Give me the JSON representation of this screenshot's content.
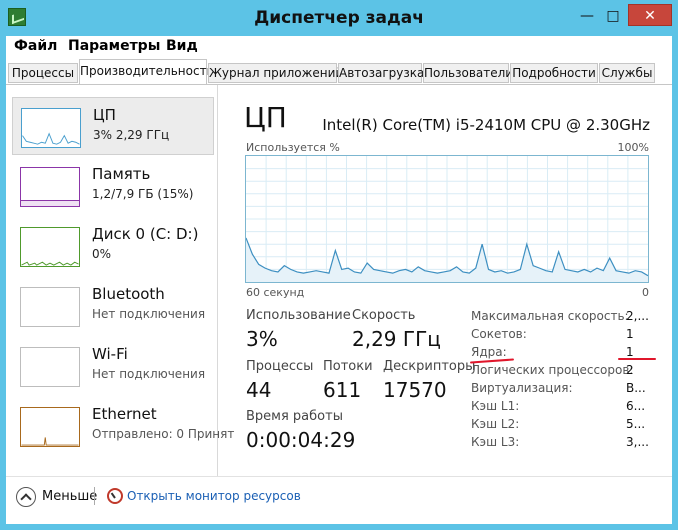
{
  "window": {
    "title": "Диспетчер задач"
  },
  "menu": [
    "Файл",
    "Параметры",
    "Вид"
  ],
  "tabs": [
    "Процессы",
    "Производительность",
    "Журнал приложений",
    "Автозагрузка",
    "Пользователи",
    "Подробности",
    "Службы"
  ],
  "active_tab": "Производительность",
  "sidebar": [
    {
      "title": "ЦП",
      "sub": "3% 2,29 ГГц",
      "color": "#4a9fce"
    },
    {
      "title": "Память",
      "sub": "1,2/7,9 ГБ (15%)",
      "color": "#8b35a8"
    },
    {
      "title": "Диск 0 (C: D:)",
      "sub": "0%",
      "color": "#4f9a2c"
    },
    {
      "title": "Bluetooth",
      "sub": "Нет подключения",
      "color": "#bdbdbd"
    },
    {
      "title": "Wi-Fi",
      "sub": "Нет подключения",
      "color": "#bdbdbd"
    },
    {
      "title": "Ethernet",
      "sub": "Отправлено: 0 Принят",
      "color": "#a8691d"
    }
  ],
  "main": {
    "title": "ЦП",
    "cpu_model": "Intel(R) Core(TM) i5-2410M CPU @ 2.30GHz",
    "graph": {
      "label_top_left": "Используется %",
      "label_top_right": "100%",
      "label_bottom_left": "60 секунд",
      "label_bottom_right": "0",
      "usage_percent": [
        35,
        22,
        14,
        11,
        9,
        8,
        13,
        10,
        8,
        7,
        8,
        9,
        8,
        7,
        25,
        10,
        11,
        8,
        7,
        15,
        10,
        9,
        8,
        7,
        9,
        10,
        8,
        12,
        9,
        8,
        7,
        8,
        9,
        12,
        8,
        7,
        11,
        30,
        10,
        8,
        9,
        7,
        8,
        10,
        30,
        13,
        11,
        9,
        8,
        24,
        10,
        9,
        8,
        10,
        8,
        11,
        9,
        19,
        9,
        8,
        7,
        9,
        8,
        5
      ]
    },
    "stats": {
      "usage_label": "Использование",
      "usage_value": "3%",
      "speed_label": "Скорость",
      "speed_value": "2,29 ГГц",
      "processes_label": "Процессы",
      "processes_value": "44",
      "threads_label": "Потоки",
      "threads_value": "611",
      "handles_label": "Дескрипторы",
      "handles_value": "17570",
      "uptime_label": "Время работы",
      "uptime_value": "0:00:04:29"
    },
    "details": [
      {
        "label": "Максимальная скорость:",
        "value": "2,..."
      },
      {
        "label": "Сокетов:",
        "value": "1"
      },
      {
        "label": "Ядра:",
        "value": "1"
      },
      {
        "label": "Логических процессоров:",
        "value": "2"
      },
      {
        "label": "Виртуализация:",
        "value": "В..."
      },
      {
        "label": "Кэш L1:",
        "value": "6..."
      },
      {
        "label": "Кэш L2:",
        "value": "5..."
      },
      {
        "label": "Кэш L3:",
        "value": "3,..."
      }
    ]
  },
  "footer": {
    "less_label": "Меньше",
    "monitor_link": "Открыть монитор ресурсов"
  }
}
